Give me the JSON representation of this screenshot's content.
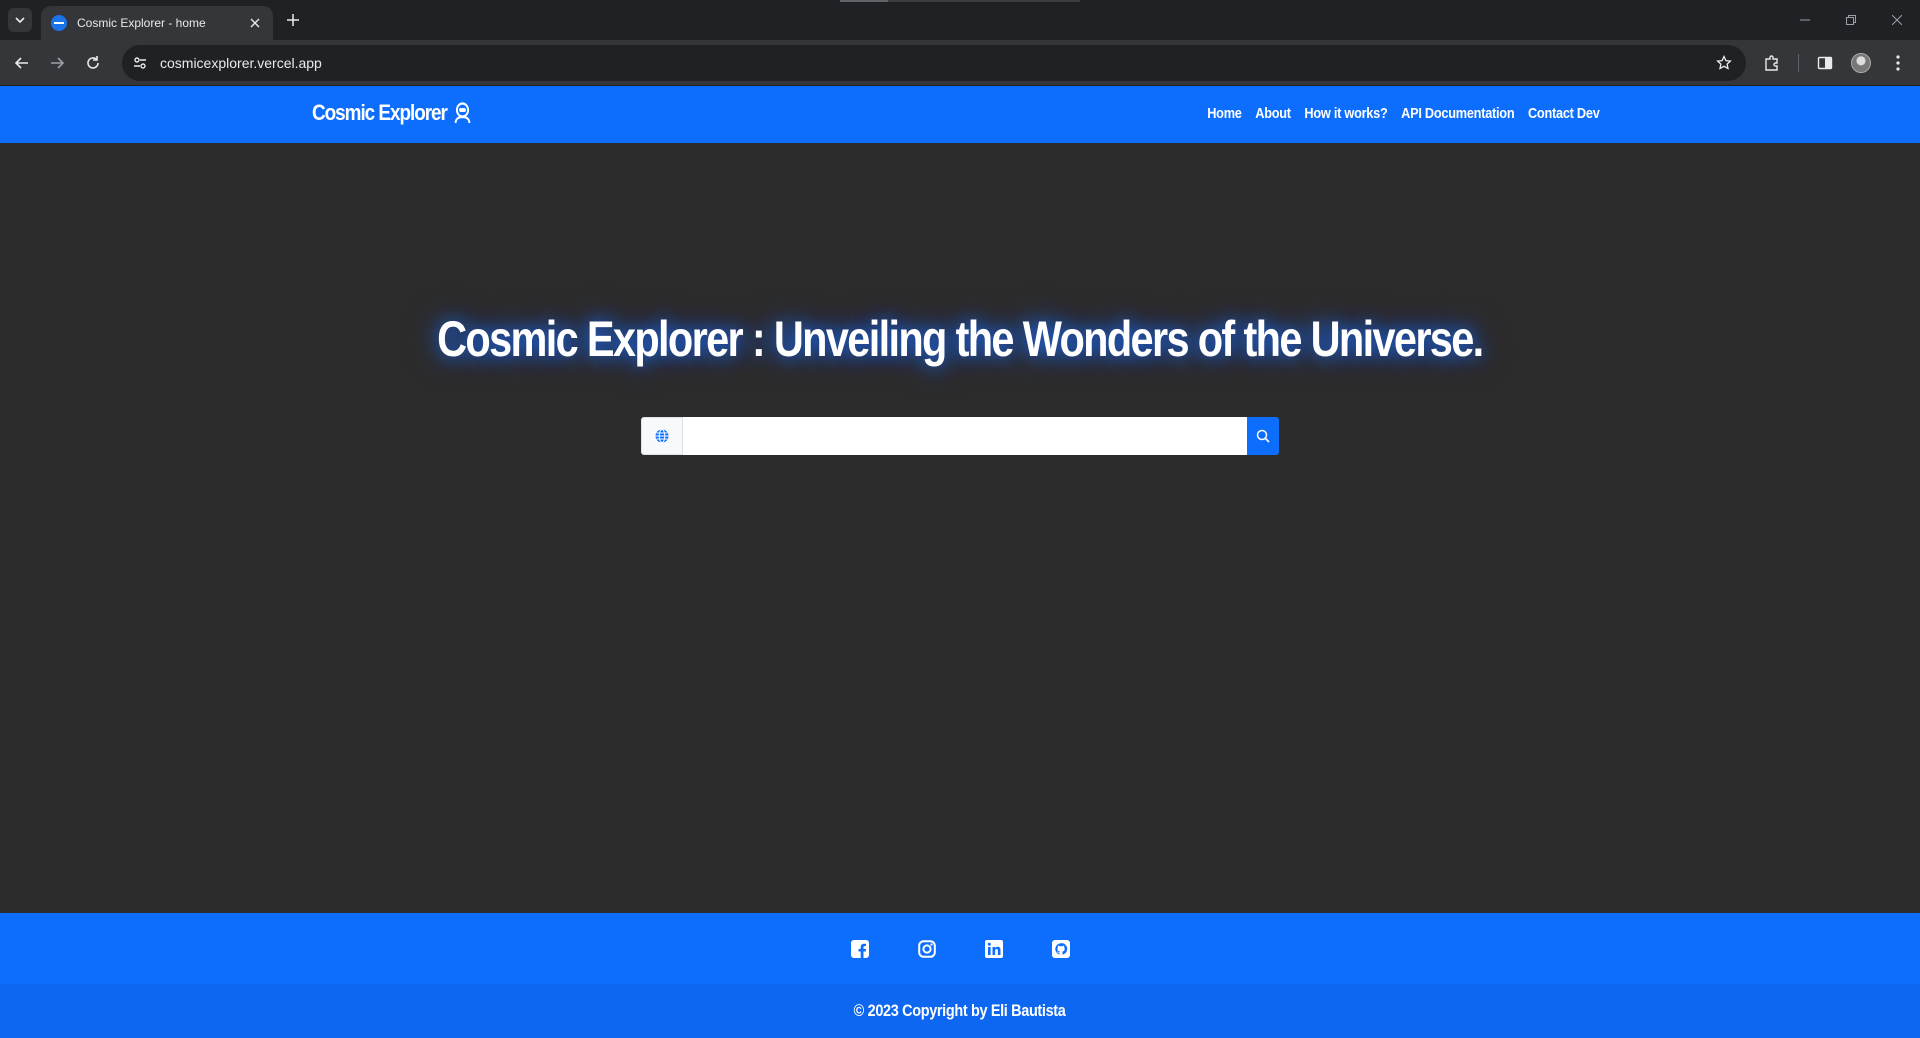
{
  "browser": {
    "tab_title": "Cosmic Explorer - home",
    "url": "cosmicexplorer.vercel.app"
  },
  "navbar": {
    "brand": "Cosmic Explorer",
    "links": [
      "Home",
      "About",
      "How it works?",
      "API Documentation",
      "Contact Dev"
    ]
  },
  "hero": {
    "title": "Cosmic Explorer : Unveiling the Wonders of the Universe.",
    "search_value": "",
    "search_placeholder": ""
  },
  "footer": {
    "social": [
      "facebook-icon",
      "instagram-icon",
      "linkedin-icon",
      "github-icon"
    ],
    "copyright": "© 2023 Copyright by Eli Bautista"
  },
  "colors": {
    "primary": "#0d6efd",
    "background": "#2c2c2c",
    "glow": "#1e6eff"
  }
}
